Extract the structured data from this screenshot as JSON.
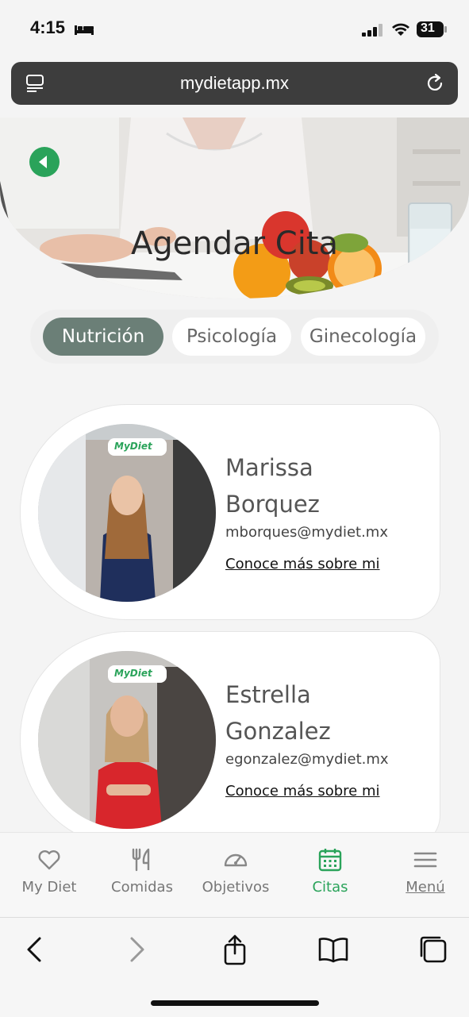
{
  "status_bar": {
    "time": "4:15",
    "battery": "31"
  },
  "browser": {
    "url": "mydietapp.mx"
  },
  "hero": {
    "title": "Agendar Cita"
  },
  "tabs": [
    {
      "label": "Nutrición",
      "active": true
    },
    {
      "label": "Psicología",
      "active": false
    },
    {
      "label": "Ginecología",
      "active": false
    }
  ],
  "specialists": [
    {
      "first_name": "Marissa",
      "last_name": "Borquez",
      "email": "mborques@mydiet.mx",
      "link": "Conoce más sobre mi",
      "shirt_color": "#1f2f5c",
      "badge": "MyDiet"
    },
    {
      "first_name": "Estrella",
      "last_name": "Gonzalez",
      "email": "egonzalez@mydiet.mx",
      "link": "Conoce más sobre mi",
      "shirt_color": "#d8262c",
      "badge": "MyDiet"
    }
  ],
  "bottom_nav": [
    {
      "label": "My Diet",
      "icon": "heart-icon"
    },
    {
      "label": "Comidas",
      "icon": "fork-knife-icon"
    },
    {
      "label": "Objetivos",
      "icon": "speedometer-icon"
    },
    {
      "label": "Citas",
      "icon": "calendar-icon",
      "active": true
    },
    {
      "label": "Menú",
      "icon": "hamburger-icon"
    }
  ],
  "colors": {
    "accent_green": "#2aa35a",
    "tab_active": "#6b7f77"
  }
}
